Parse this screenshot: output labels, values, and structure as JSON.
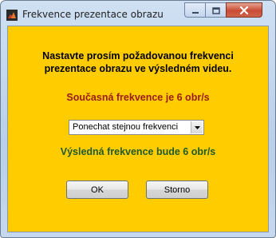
{
  "window": {
    "title": "Frekvence prezentace obrazu"
  },
  "dialog": {
    "instruction_line1": "Nastavte prosím požadovanou frekvenci",
    "instruction_line2": "prezentace obrazu ve výsledném videu.",
    "current_rate_text": "Současná frekvence je 6 obr/s",
    "rate_select": {
      "selected": "Ponechat stejnou frekvenci"
    },
    "result_rate_text": "Výsledná frekvence bude 6 obr/s",
    "ok_label": "OK",
    "cancel_label": "Storno"
  },
  "colors": {
    "background": "#ffcc00",
    "current_rate": "#9a1a1a",
    "result_rate": "#1f5a2a"
  },
  "icons": {
    "app": "matlab-icon",
    "minimize": "minimize-icon",
    "maximize": "maximize-icon",
    "close": "close-icon",
    "dropdown": "chevron-down-icon"
  }
}
